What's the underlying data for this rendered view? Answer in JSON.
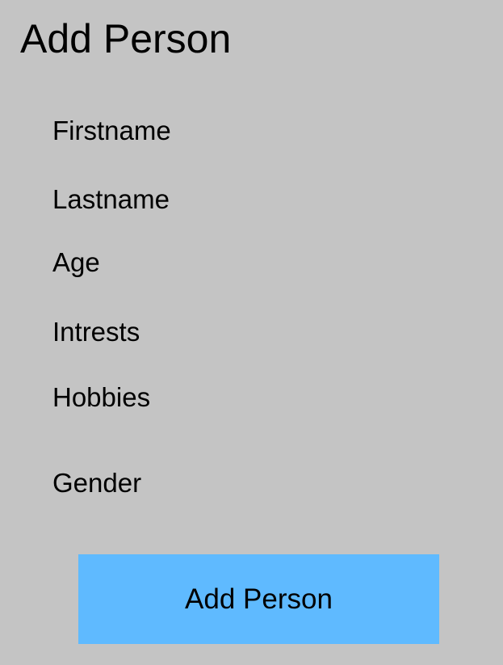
{
  "form": {
    "title": "Add Person",
    "fields": {
      "firstname": "Firstname",
      "lastname": "Lastname",
      "age": "Age",
      "interests": "Intrests",
      "hobbies": "Hobbies",
      "gender": "Gender"
    },
    "submit_label": "Add Person"
  },
  "colors": {
    "background": "#c4c4c4",
    "button": "#5fbaff",
    "text": "#000000"
  }
}
